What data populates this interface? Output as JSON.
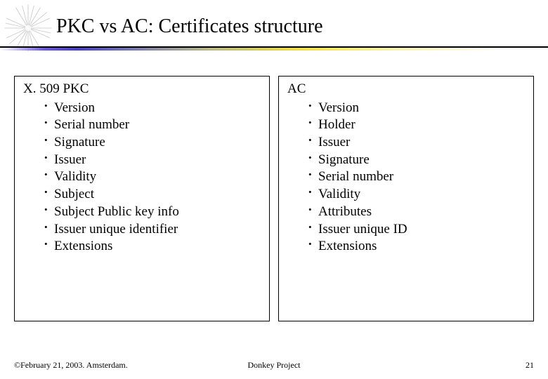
{
  "title": "PKC vs AC: Certificates structure",
  "left": {
    "heading": "X. 509 PKC",
    "items": [
      "Version",
      "Serial number",
      "Signature",
      "Issuer",
      "Validity",
      "Subject",
      "Subject Public key info",
      "Issuer unique identifier",
      "Extensions"
    ]
  },
  "right": {
    "heading": "AC",
    "items": [
      "Version",
      "Holder",
      "Issuer",
      "Signature",
      "Serial number",
      "Validity",
      "Attributes",
      "Issuer unique ID",
      "Extensions"
    ]
  },
  "footer": {
    "left": "©February 21, 2003. Amsterdam.",
    "center": "Donkey Project",
    "right": "21"
  }
}
